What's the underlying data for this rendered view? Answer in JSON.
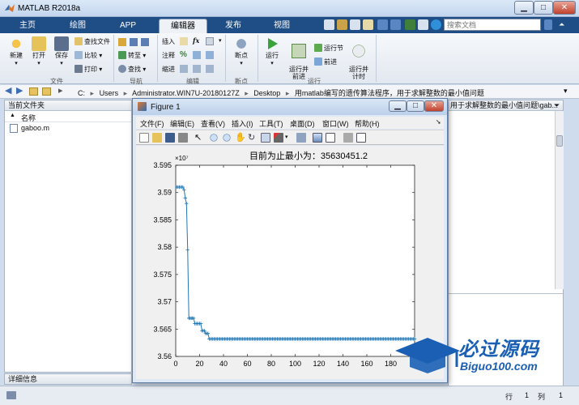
{
  "window": {
    "title": "MATLAB R2018a",
    "btn_min": "▁",
    "btn_max": "□",
    "btn_close": "✕"
  },
  "tabs": [
    "主页",
    "绘图",
    "APP",
    "编辑器",
    "发布",
    "视图"
  ],
  "active_tab": "编辑器",
  "search": {
    "placeholder": "搜索文档"
  },
  "collapse_label": "⏶",
  "ribbon": {
    "file_group": {
      "label": "文件",
      "new": "新建",
      "open": "打开",
      "save": "保存",
      "find_files": "查找文件",
      "compare": "比较",
      "print": "打印"
    },
    "nav_group": {
      "label": "导航",
      "goto": "转至",
      "find": "查找"
    },
    "edit_group": {
      "label": "编辑",
      "insert": "插入",
      "comment": "注释",
      "indent": "缩进",
      "fx": "fx"
    },
    "breakpoint_group": {
      "label": "断点",
      "breakpoints": "断点"
    },
    "run_group": {
      "label": "运行",
      "run": "运行",
      "run_advance": "运行并\n前进",
      "run_section": "运行节",
      "advance": "前进",
      "run_time": "运行并\n计时"
    }
  },
  "address": {
    "segments": [
      "C:",
      "Users",
      "Administrator.WIN7U-20180127Z",
      "Desktop",
      "用matlab编写的遗传算法程序，用于求解整数的最小值问题"
    ],
    "sep": "▸"
  },
  "current_folder": {
    "title": "当前文件夹",
    "column": "名称",
    "sort_arrow": "▲",
    "files": [
      {
        "name": "gaboo.m"
      }
    ]
  },
  "details": {
    "title": "详细信息"
  },
  "editor_tab": "用于求解整数的最小值问题\\gab...",
  "status": {
    "row_label": "行",
    "row": "1",
    "col_label": "列",
    "col": "1"
  },
  "figure": {
    "title": "Figure 1",
    "menu": [
      "文件(F)",
      "编辑(E)",
      "查看(V)",
      "插入(I)",
      "工具(T)",
      "桌面(D)",
      "窗口(W)",
      "帮助(H)"
    ],
    "menu_arrow": "➘",
    "tool_icons": [
      "new-figure-icon",
      "open-icon",
      "save-icon",
      "print-icon",
      "pointer-icon",
      "zoom-in-icon",
      "zoom-out-icon",
      "pan-icon",
      "rotate-icon",
      "data-cursor-icon",
      "brush-icon",
      "link-icon",
      "colorbar-icon",
      "legend-icon",
      "hide-plot-tools-icon",
      "show-plot-tools-icon"
    ]
  },
  "chart_data": {
    "type": "line",
    "title": "目前为止最小为：35630451.2",
    "exponent_label": "×10⁷",
    "xlabel": "",
    "ylabel": "",
    "xlim": [
      0,
      200
    ],
    "ylim": [
      3.56,
      3.595
    ],
    "xticks": [
      0,
      20,
      40,
      60,
      80,
      100,
      120,
      140,
      160,
      180
    ],
    "yticks": [
      3.56,
      3.565,
      3.57,
      3.575,
      3.58,
      3.585,
      3.59,
      3.595
    ],
    "grid": false,
    "marker": "+",
    "color": "#1f77b4",
    "segments": [
      {
        "x_from": 1,
        "x_to": 6,
        "y": 3.591
      },
      {
        "x_from": 7,
        "x_to": 7,
        "y": 3.5905
      },
      {
        "x_from": 8,
        "x_to": 8,
        "y": 3.589
      },
      {
        "x_from": 9,
        "x_to": 9,
        "y": 3.588
      },
      {
        "x_from": 10,
        "x_to": 10,
        "y": 3.5795
      },
      {
        "x_from": 11,
        "x_to": 15,
        "y": 3.567
      },
      {
        "x_from": 16,
        "x_to": 21,
        "y": 3.566
      },
      {
        "x_from": 22,
        "x_to": 24,
        "y": 3.5647
      },
      {
        "x_from": 25,
        "x_to": 27,
        "y": 3.5642
      },
      {
        "x_from": 28,
        "x_to": 200,
        "y": 3.5632
      }
    ]
  },
  "watermark": {
    "brand_cn": "必过源码",
    "brand_en": "Biguo100.com"
  },
  "colors": {
    "accent": "#1f4e86",
    "line": "#1f77b4",
    "watermark_blue": "#1a5fb4"
  }
}
